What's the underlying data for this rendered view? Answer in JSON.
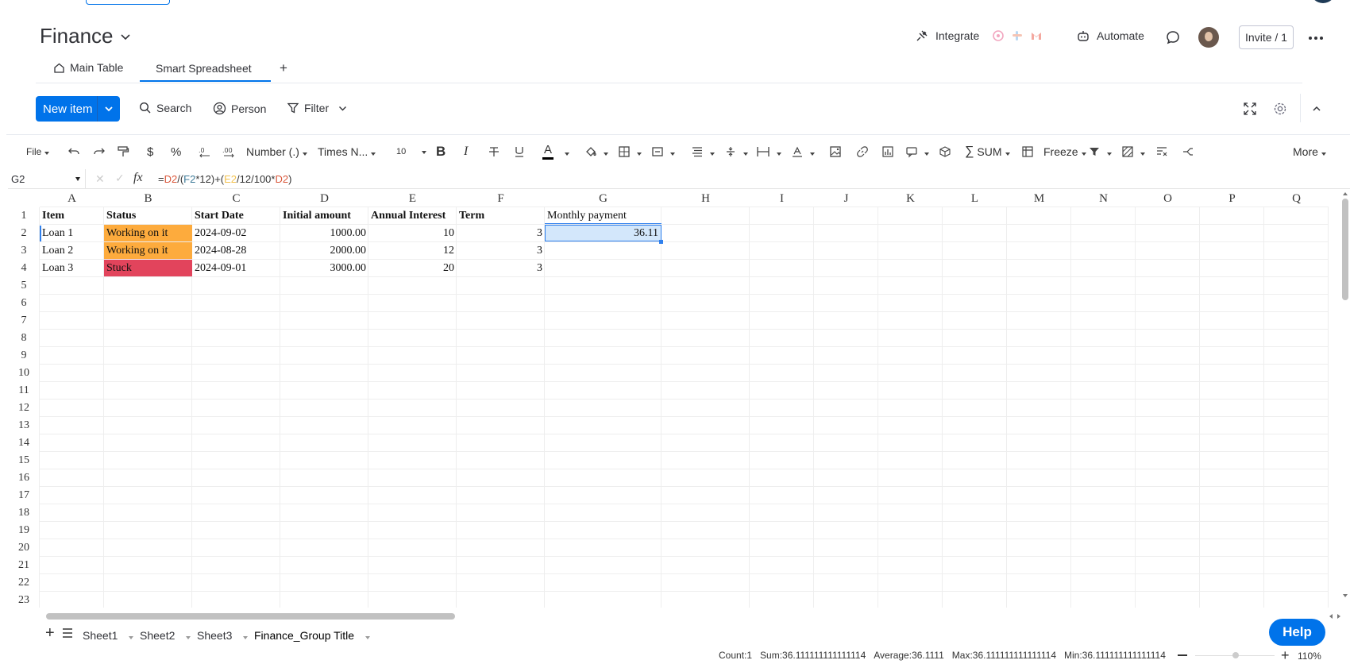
{
  "board": {
    "title": "Finance",
    "integrate_label": "Integrate",
    "automate_label": "Automate",
    "invite_label": "Invite / 1"
  },
  "tabs": [
    {
      "label": "Main Table"
    },
    {
      "label": "Smart Spreadsheet"
    },
    {
      "label": "+"
    }
  ],
  "toolbar": {
    "new_item_label": "New item",
    "search_label": "Search",
    "person_label": "Person",
    "filter_label": "Filter"
  },
  "ss_toolbar": {
    "file": "File",
    "currency": "$",
    "percent": "%",
    "number_format": "Number (.)",
    "font": "Times N...",
    "font_size": "10",
    "bold": "B",
    "italic": "I",
    "text_color": "A",
    "sum": "SUM",
    "freeze": "Freeze",
    "more": "More"
  },
  "formula_bar": {
    "cell_ref": "G2",
    "fx": "fx",
    "formula_parts": [
      "=",
      "D2",
      "/(",
      "F2",
      "*12)+(",
      "E2",
      "/12/100*",
      "D2",
      ")"
    ]
  },
  "grid": {
    "columns": [
      "A",
      "B",
      "C",
      "D",
      "E",
      "F",
      "G",
      "H",
      "I",
      "J",
      "K",
      "L",
      "M",
      "N",
      "O",
      "P",
      "Q"
    ],
    "rows": [
      "1",
      "2",
      "3",
      "4",
      "5",
      "6",
      "7",
      "8",
      "9",
      "10",
      "11",
      "12",
      "13",
      "14",
      "15",
      "16",
      "17",
      "18",
      "19",
      "20",
      "21",
      "22",
      "23"
    ],
    "headers": [
      "Item",
      "Status",
      "Start Date",
      "Initial amount",
      "Annual Interest",
      "Term",
      "Monthly payment"
    ],
    "data": [
      {
        "item": "Loan 1",
        "status": "Working on it",
        "date": "2024-09-02",
        "amount": "1000.00",
        "interest": "10",
        "term": "3",
        "payment": "36.11"
      },
      {
        "item": "Loan 2",
        "status": "Working on it",
        "date": "2024-08-28",
        "amount": "2000.00",
        "interest": "12",
        "term": "3",
        "payment": ""
      },
      {
        "item": "Loan 3",
        "status": "Stuck",
        "date": "2024-09-01",
        "amount": "3000.00",
        "interest": "20",
        "term": "3",
        "payment": ""
      }
    ],
    "status_colors": {
      "Working on it": "#fdab3d",
      "Stuck": "#e2445c"
    },
    "selected_cell": "G2"
  },
  "sheets": [
    {
      "label": "Sheet1"
    },
    {
      "label": "Sheet2"
    },
    {
      "label": "Sheet3"
    },
    {
      "label": "Finance_Group Title"
    }
  ],
  "status_bar": {
    "count": "Count:1",
    "sum": "Sum:36.111111111111114",
    "average": "Average:36.1111",
    "max": "Max:36.111111111111114",
    "min": "Min:36.111111111111114",
    "zoom": "110%"
  },
  "help_label": "Help",
  "colors": {
    "accent": "#0073ea",
    "selection_fill": "#d3e7fb",
    "selection_border": "#2f80ed"
  }
}
